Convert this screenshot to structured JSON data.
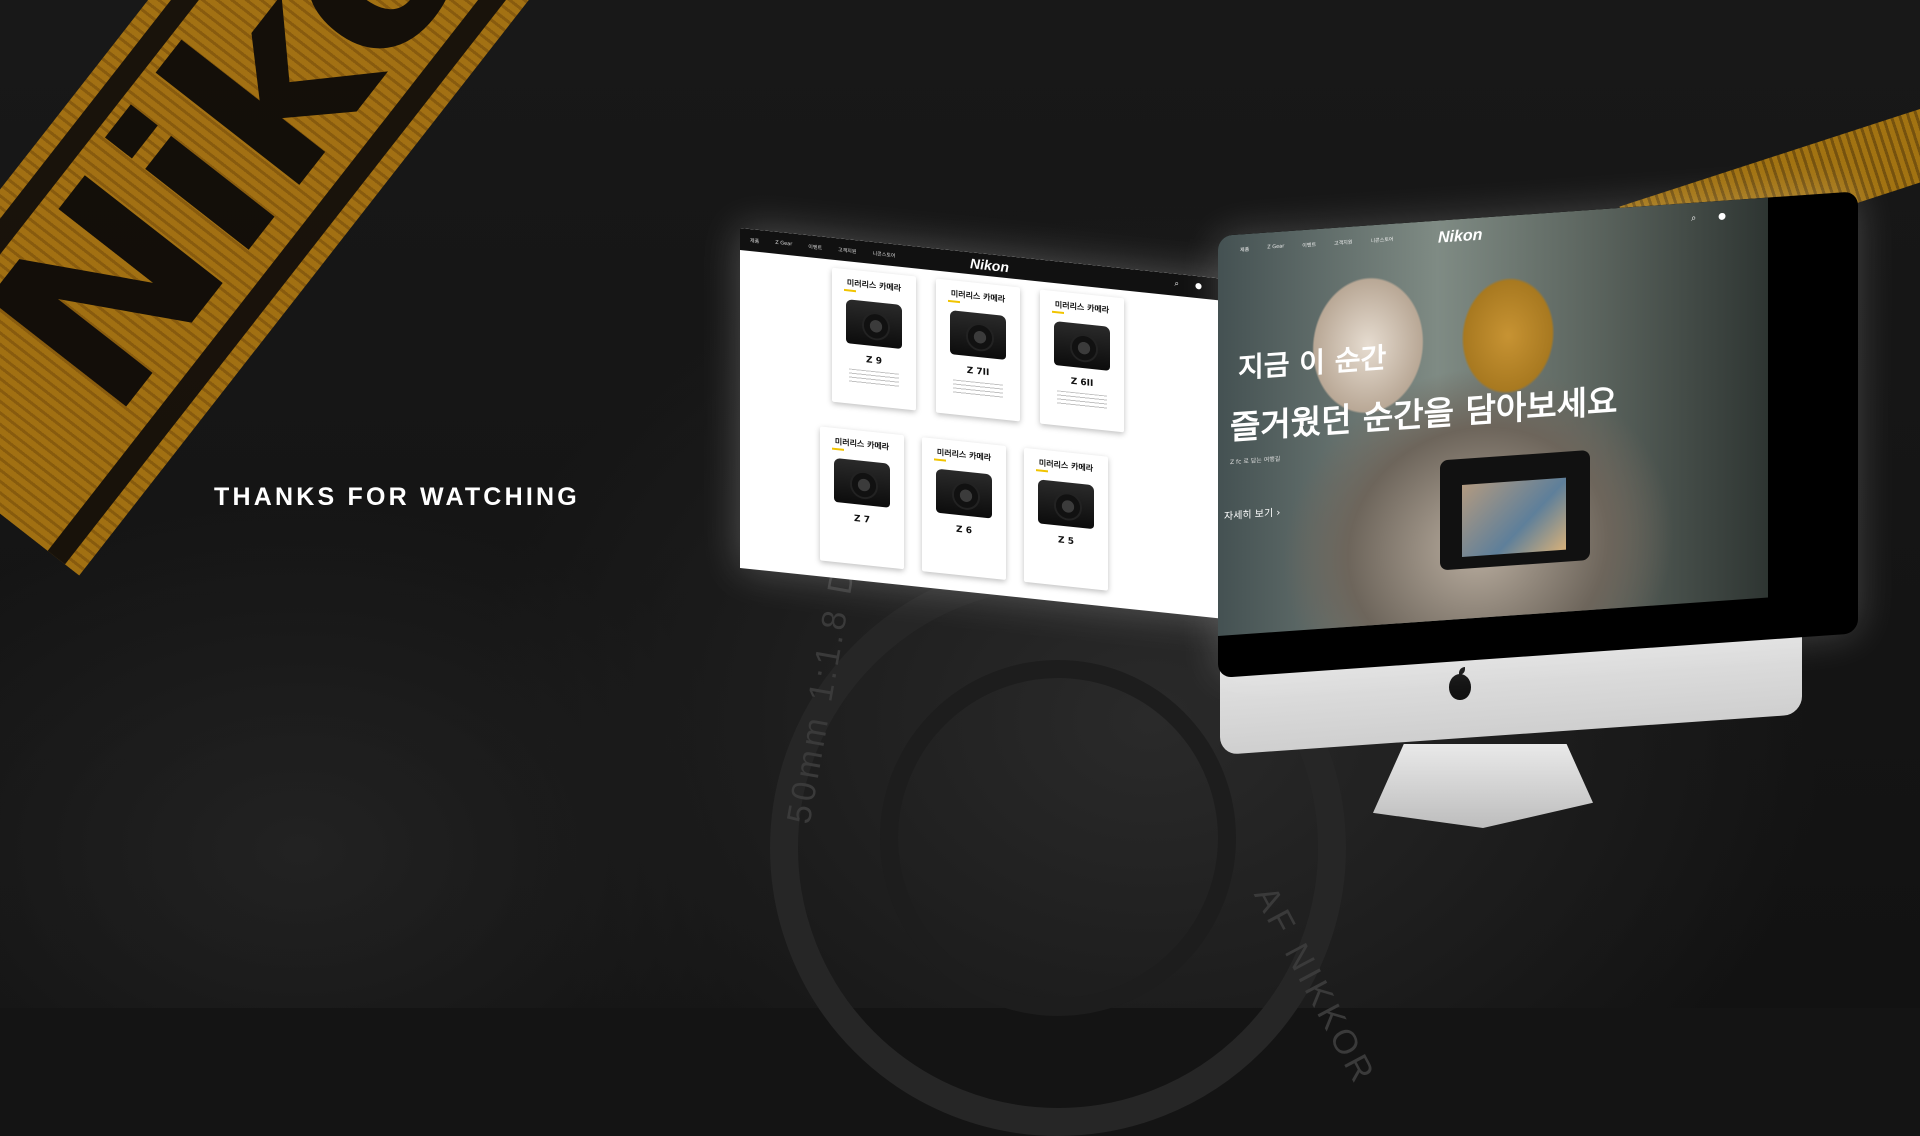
{
  "background": {
    "strap_letters": "Nikon",
    "lens_text_1": "50mm 1:1.8 D",
    "lens_text_2": "AF NIKKOR"
  },
  "headline": "THANKS FOR WATCHING",
  "product_page": {
    "logo": "Nikon",
    "nav": [
      "제품",
      "Z Gear",
      "이벤트",
      "고객지원",
      "니콘스토어"
    ],
    "icons": [
      "search-icon",
      "user-icon"
    ],
    "cards": [
      {
        "category": "미러리스 카메라",
        "name": "Z 9"
      },
      {
        "category": "미러리스 카메라",
        "name": "Z 7II"
      },
      {
        "category": "미러리스 카메라",
        "name": "Z 6II"
      },
      {
        "category": "미러리스 카메라",
        "name": "Z 7"
      },
      {
        "category": "미러리스 카메라",
        "name": "Z 6"
      },
      {
        "category": "미러리스 카메라",
        "name": "Z 5"
      }
    ]
  },
  "hero_page": {
    "logo": "Nikon",
    "nav": [
      "제품",
      "Z Gear",
      "이벤트",
      "고객지원",
      "니콘스토어"
    ],
    "icons": [
      "search-icon",
      "user-icon"
    ],
    "title_line1": "지금 이 순간",
    "title_line2": "즐거웠던 순간을 담아보세요",
    "subtitle": "Z fc 로 담는 여행길",
    "more_link": "자세히 보기  ›"
  },
  "colors": {
    "accent_yellow": "#f1c400",
    "strap_orange": "#c98a12",
    "background": "#141414"
  }
}
